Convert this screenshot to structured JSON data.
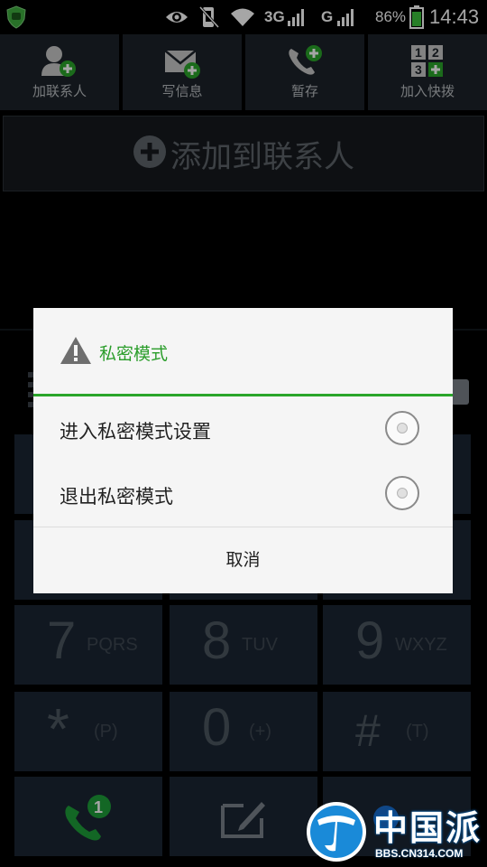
{
  "status_bar": {
    "network_3g": "3G",
    "network_g": "G",
    "battery": "86%",
    "time": "14:43"
  },
  "toolbar": [
    {
      "label": "加联系人",
      "icon": "add-contact-icon"
    },
    {
      "label": "写信息",
      "icon": "message-icon"
    },
    {
      "label": "暂存",
      "icon": "save-call-icon"
    },
    {
      "label": "加入快拨",
      "icon": "speed-dial-icon"
    }
  ],
  "add_to_contacts": "添加到联系人",
  "keypad": [
    {
      "digit": "7",
      "letters": "PQRS"
    },
    {
      "digit": "8",
      "letters": "TUV"
    },
    {
      "digit": "9",
      "letters": "WXYZ"
    },
    {
      "digit": "*",
      "letters": "(P)"
    },
    {
      "digit": "0",
      "letters": "(+)"
    },
    {
      "digit": "#",
      "letters": "(T)"
    }
  ],
  "call_badge": "1",
  "dialog": {
    "title": "私密模式",
    "options": [
      "进入私密模式设置",
      "退出私密模式"
    ],
    "cancel": "取消"
  },
  "watermark": {
    "name": "中国派",
    "url": "BBS.CN314.COM"
  },
  "colors": {
    "accent_green": "#2aa52a",
    "keypad_bg": "#1b2633",
    "toolbar_bg": "#1d232a"
  }
}
